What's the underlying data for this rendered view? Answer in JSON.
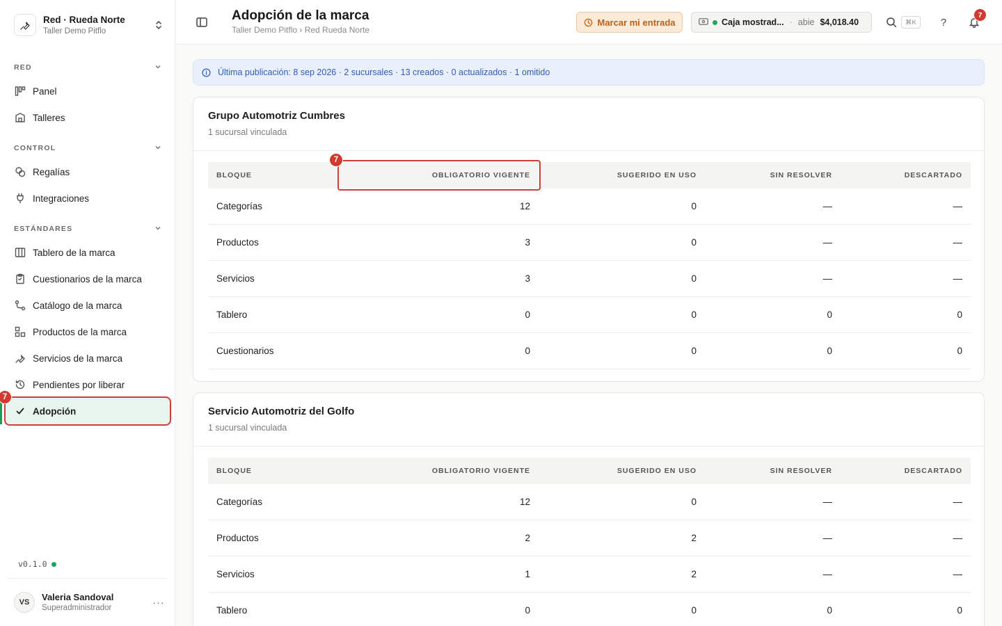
{
  "org": {
    "name": "Red · Rueda Norte",
    "subtitle": "Taller Demo Pitflo"
  },
  "sidebar": {
    "sections": [
      {
        "title": "RED",
        "items": [
          {
            "label": "Panel",
            "icon": "panel-icon"
          },
          {
            "label": "Talleres",
            "icon": "building-icon"
          }
        ]
      },
      {
        "title": "CONTROL",
        "items": [
          {
            "label": "Regalías",
            "icon": "coins-icon"
          },
          {
            "label": "Integraciones",
            "icon": "plug-icon"
          }
        ]
      },
      {
        "title": "ESTÁNDARES",
        "items": [
          {
            "label": "Tablero de la marca",
            "icon": "columns-icon"
          },
          {
            "label": "Cuestionarios de la marca",
            "icon": "clipboard-icon"
          },
          {
            "label": "Catálogo de la marca",
            "icon": "route-icon"
          },
          {
            "label": "Productos de la marca",
            "icon": "boxes-icon"
          },
          {
            "label": "Servicios de la marca",
            "icon": "wrench-icon"
          },
          {
            "label": "Pendientes por liberar",
            "icon": "history-icon"
          },
          {
            "label": "Adopción",
            "icon": "check-icon",
            "active": true
          }
        ]
      }
    ],
    "active_badge": "7",
    "version": "v0.1.0"
  },
  "user": {
    "initials": "VS",
    "name": "Valeria Sandoval",
    "role": "Superadministrador"
  },
  "header": {
    "title": "Adopción de la marca",
    "breadcrumb": "Taller Demo Pitflo › Red Rueda Norte",
    "checkin_label": "Marcar mi entrada",
    "register": {
      "name": "Caja mostrad...",
      "status": "abie",
      "amount": "$4,018.40"
    },
    "shortcut": "⌘K",
    "help": "?",
    "notifications": "7"
  },
  "banner": {
    "text": "Última publicación: 8 sep 2026 · 2 sucursales · 13 creados · 0 actualizados · 1 omitido"
  },
  "columns": [
    "BLOQUE",
    "OBLIGATORIO VIGENTE",
    "SUGERIDO EN USO",
    "SIN RESOLVER",
    "DESCARTADO"
  ],
  "groups": [
    {
      "title": "Grupo Automotriz Cumbres",
      "subtitle": "1 sucursal vinculada",
      "highlight_badge": "7",
      "rows": [
        [
          "Categorías",
          "12",
          "0",
          "—",
          "—"
        ],
        [
          "Productos",
          "3",
          "0",
          "—",
          "—"
        ],
        [
          "Servicios",
          "3",
          "0",
          "—",
          "—"
        ],
        [
          "Tablero",
          "0",
          "0",
          "0",
          "0"
        ],
        [
          "Cuestionarios",
          "0",
          "0",
          "0",
          "0"
        ]
      ]
    },
    {
      "title": "Servicio Automotriz del Golfo",
      "subtitle": "1 sucursal vinculada",
      "rows": [
        [
          "Categorías",
          "12",
          "0",
          "—",
          "—"
        ],
        [
          "Productos",
          "2",
          "2",
          "—",
          "—"
        ],
        [
          "Servicios",
          "1",
          "2",
          "—",
          "—"
        ],
        [
          "Tablero",
          "0",
          "0",
          "0",
          "0"
        ]
      ]
    }
  ]
}
